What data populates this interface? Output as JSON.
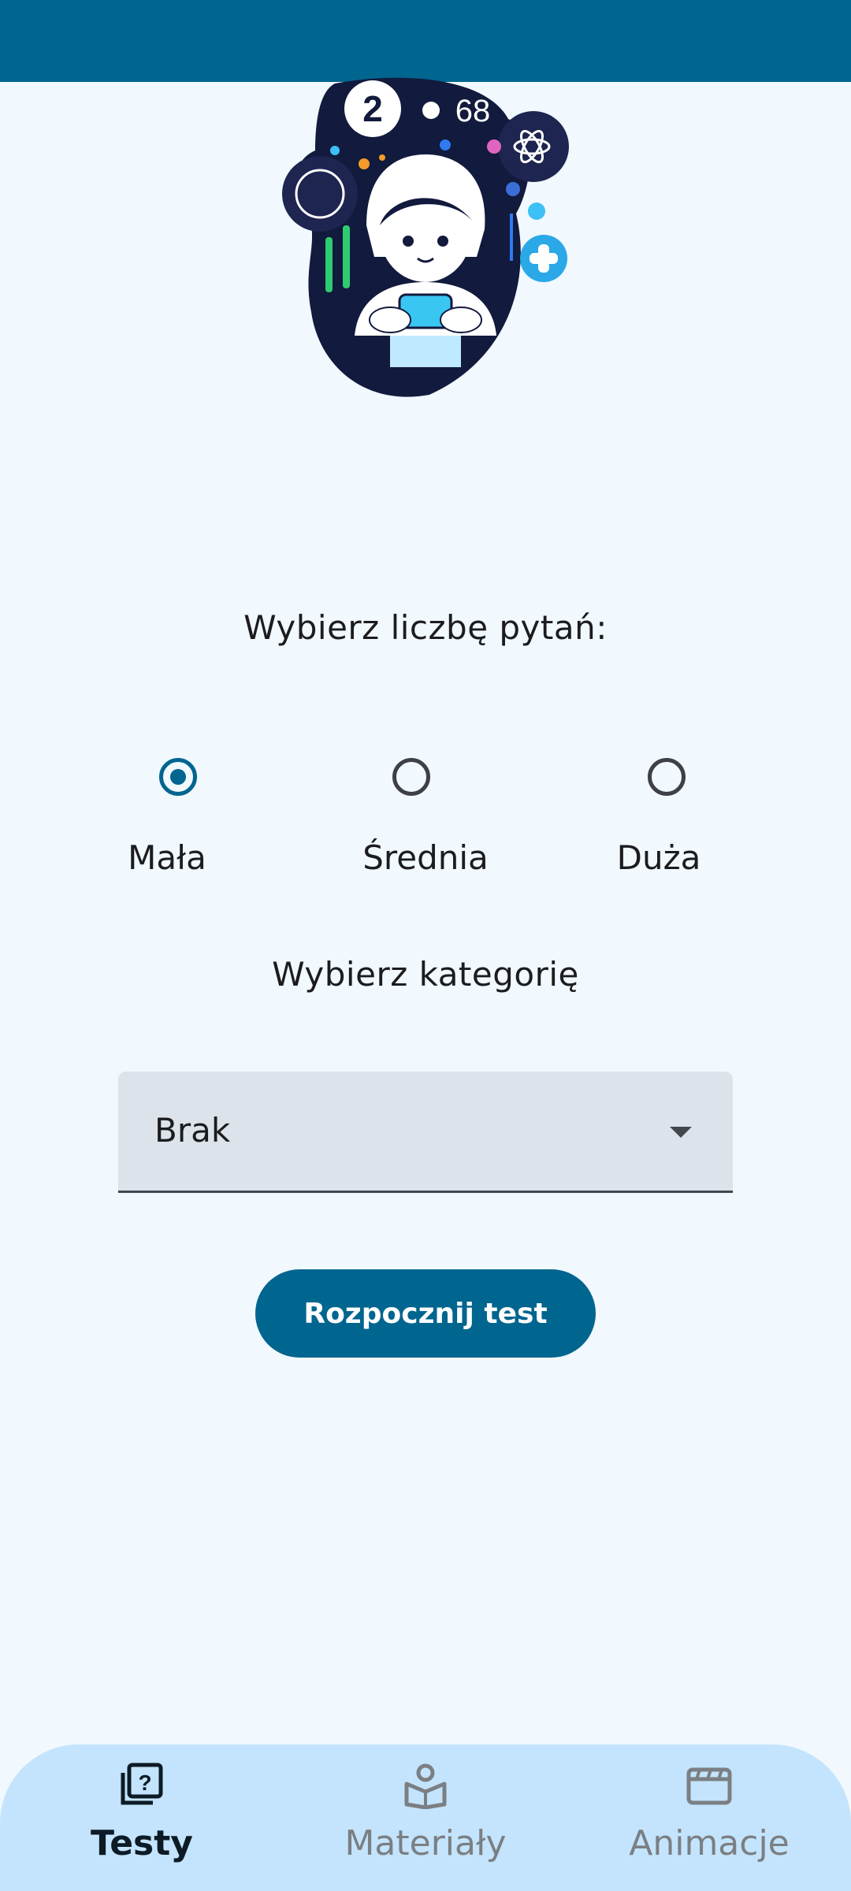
{
  "quiz": {
    "question_count_title": "Wybierz liczbę pytań:",
    "options": [
      {
        "label": "Mała",
        "selected": true
      },
      {
        "label": "Średnia",
        "selected": false
      },
      {
        "label": "Duża",
        "selected": false
      }
    ],
    "category_title": "Wybierz kategorię",
    "category_value": "Brak",
    "start_label": "Rozpocznij test"
  },
  "hero": {
    "badge_number": "2",
    "badge_text": "68"
  },
  "nav": {
    "items": [
      {
        "label": "Testy",
        "icon": "quiz-icon",
        "active": true
      },
      {
        "label": "Materiały",
        "icon": "book-reader-icon",
        "active": false
      },
      {
        "label": "Animacje",
        "icon": "clapperboard-icon",
        "active": false
      }
    ]
  },
  "colors": {
    "primary": "#00658f",
    "background": "#f1f8fe",
    "nav_background": "#c3e4fc",
    "dropdown_background": "#dde3ea"
  }
}
